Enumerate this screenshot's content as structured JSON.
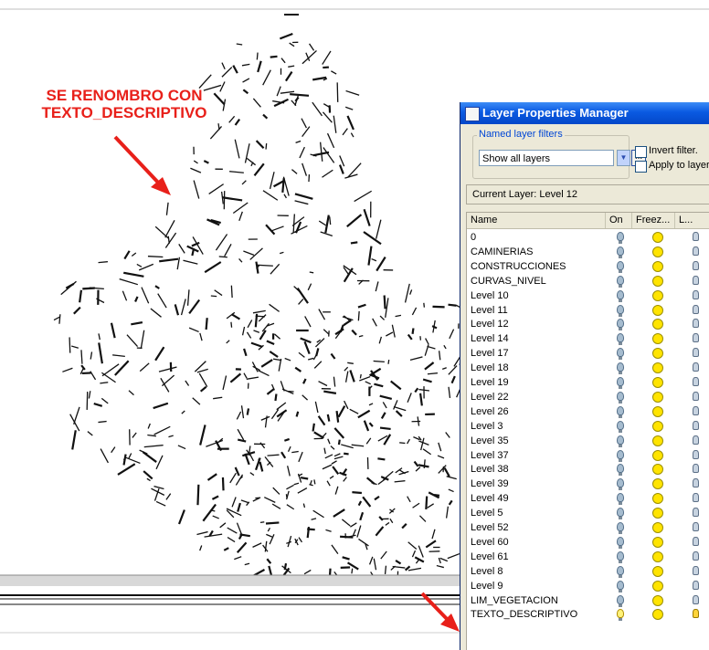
{
  "annotation": {
    "line1": "SE RENOMBRO CON",
    "line2": "TEXTO_DESCRIPTIVO"
  },
  "colors": {
    "annotation_red": "#e8201a",
    "xp_title_blue": "#0a5ae2"
  },
  "layer_manager": {
    "title": "Layer Properties Manager",
    "named_layer_filters_label": "Named layer filters",
    "filter_value": "Show all layers",
    "invert_filter_label": "Invert filter.",
    "apply_to_layers_label": "Apply to layers",
    "current_layer_label": "Current Layer:",
    "current_layer_value": "Level 12",
    "columns": {
      "name": "Name",
      "on": "On",
      "freeze": "Freez...",
      "lock": "L..."
    },
    "layers": [
      "0",
      "CAMINERIAS",
      "CONSTRUCCIONES",
      "CURVAS_NIVEL",
      "Level 10",
      "Level 11",
      "Level 12",
      "Level 14",
      "Level 17",
      "Level 18",
      "Level 19",
      "Level 22",
      "Level 26",
      "Level 3",
      "Level 35",
      "Level 37",
      "Level 38",
      "Level 39",
      "Level 49",
      "Level 5",
      "Level 52",
      "Level 60",
      "Level 61",
      "Level 8",
      "Level 9",
      "LIM_VEGETACION",
      "TEXTO_DESCRIPTIVO"
    ],
    "highlighted_layer": "TEXTO_DESCRIPTIVO",
    "icons": {
      "on": "lightbulb-icon",
      "freeze": "sun-icon",
      "lock": "lock-icon"
    }
  }
}
